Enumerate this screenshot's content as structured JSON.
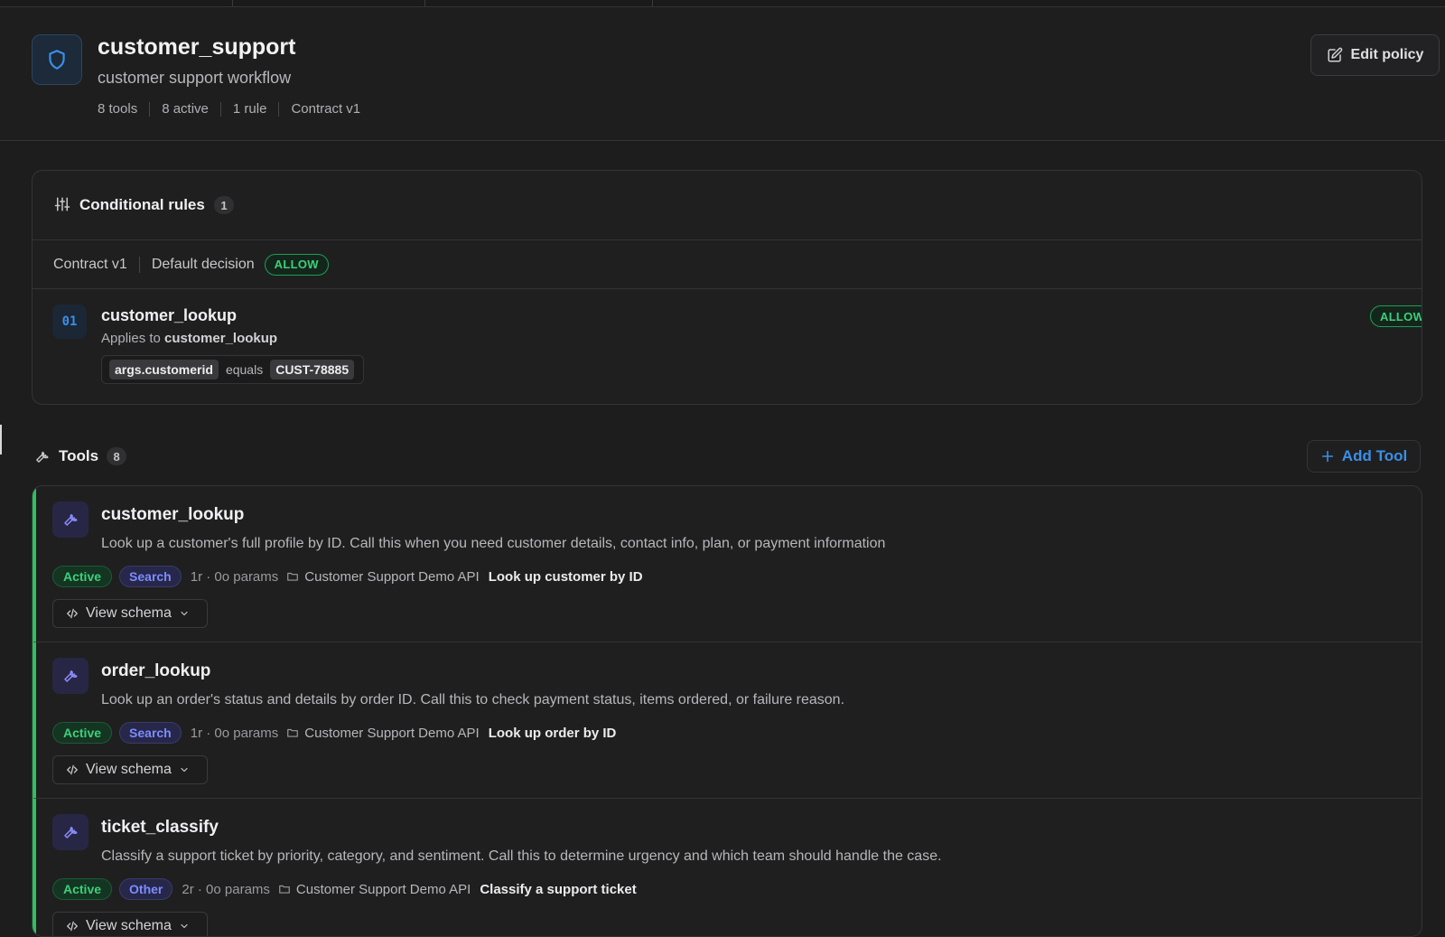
{
  "policy": {
    "name": "customer_support",
    "description": "customer support workflow",
    "meta": [
      "8 tools",
      "8 active",
      "1 rule",
      "Contract v1"
    ],
    "edit_label": "Edit policy"
  },
  "rules": {
    "title": "Conditional rules",
    "count": "1",
    "contract": "Contract v1",
    "default_label": "Default decision",
    "default_decision": "ALLOW",
    "items": [
      {
        "index": "01",
        "name": "customer_lookup",
        "applies_prefix": "Applies to",
        "applies_to": "customer_lookup",
        "field": "args.customerid",
        "operator": "equals",
        "value": "CUST-78885",
        "decision": "ALLOW"
      }
    ]
  },
  "tools": {
    "title": "Tools",
    "count": "8",
    "add_label": "Add Tool",
    "schema_label": "View schema",
    "items": [
      {
        "name": "customer_lookup",
        "description": "Look up a customer's full profile by ID. Call this when you need customer details, contact info, plan, or payment information",
        "status": "Active",
        "category": "Search",
        "params": "1r · 0o params",
        "api": "Customer Support Demo API",
        "operation": "Look up customer by ID"
      },
      {
        "name": "order_lookup",
        "description": "Look up an order's status and details by order ID. Call this to check payment status, items ordered, or failure reason.",
        "status": "Active",
        "category": "Search",
        "params": "1r · 0o params",
        "api": "Customer Support Demo API",
        "operation": "Look up order by ID"
      },
      {
        "name": "ticket_classify",
        "description": "Classify a support ticket by priority, category, and sentiment. Call this to determine urgency and which team should handle the case.",
        "status": "Active",
        "category": "Other",
        "params": "2r · 0o params",
        "api": "Customer Support Demo API",
        "operation": "Classify a support ticket"
      }
    ]
  },
  "colors": {
    "background": "#1d1d1e",
    "accent_blue": "#3b8fe6",
    "active_green": "#3ecf7a",
    "category_purple": "#7c8cff"
  },
  "icons": {
    "policy": "shield-icon",
    "rules": "sliders-icon",
    "tools": "wrench-icon",
    "edit": "pencil-icon",
    "add": "plus-icon",
    "api": "folder-icon",
    "schema": "code-icon",
    "expand": "chevron-down-icon"
  }
}
